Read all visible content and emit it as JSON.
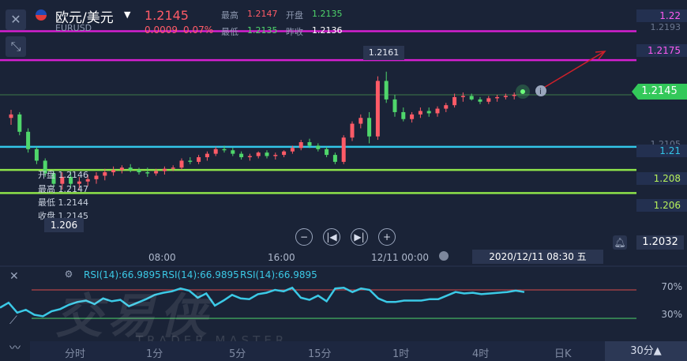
{
  "header": {
    "title": "欧元/美元",
    "symbol": "EURUSD",
    "last": "1.2145",
    "change": "0.0009",
    "change_pct": "0.07%",
    "high_label": "最高",
    "high": "1.2147",
    "open_label": "开盘",
    "open": "1.2135",
    "low_label": "最低",
    "low": "1.2135",
    "prev_label": "昨收",
    "prev": "1.2136"
  },
  "price_axis": {
    "tags": [
      {
        "name": "level-1.22",
        "value": "1.22",
        "color": "#d51fd0"
      },
      {
        "name": "level-1.2175",
        "value": "1.2175",
        "color": "#d51fd0"
      },
      {
        "name": "level-1.21",
        "value": "1.21",
        "color": "#33c6e8"
      },
      {
        "name": "level-1.208",
        "value": "1.208",
        "color": "#8ee34a"
      },
      {
        "name": "level-1.206",
        "value": "1.206",
        "color": "#8ee34a"
      }
    ],
    "faint_ticks": [
      "1.2193",
      "1.2105"
    ],
    "current_price": "1.2145",
    "alert_price": "1.2032",
    "peak_label": "1.2161"
  },
  "ohlc_tooltip": {
    "open_label": "开盘",
    "open": "1.2146",
    "high_label": "最高",
    "high": "1.2147",
    "low_label": "最低",
    "low": "1.2144",
    "close_label": "收盘",
    "close": "1.2145",
    "hover_price": "1.206"
  },
  "time_axis": {
    "ticks": [
      "08:00",
      "16:00",
      "12/11 00:00"
    ],
    "crosshair_time": "2020/12/11 08:30 五"
  },
  "rsi": {
    "labels": [
      "RSI(14):66.9895",
      "RSI(14):66.9895",
      "RSI(14):66.9895"
    ],
    "levels": [
      "70%",
      "30%"
    ]
  },
  "timeframes": [
    "分时",
    "1分",
    "5分",
    "15分",
    "1时",
    "4时",
    "日K",
    "30分▲"
  ],
  "watermark": {
    "main": "交易侠",
    "sub": "TRADER MASTER"
  },
  "colors": {
    "up": "#ff5b67",
    "down": "#4fd66b",
    "rsi": "#3bc9e6",
    "magenta": "#d51fd0",
    "cyan": "#33c6e8",
    "lime": "#8ee34a"
  },
  "chart_data": {
    "type": "candlestick",
    "ylim": [
      1.2022,
      1.2227
    ],
    "levels": [
      1.22,
      1.2175,
      1.21,
      1.208,
      1.206
    ],
    "current": 1.2145,
    "candles": [
      [
        1.2125,
        1.2132,
        1.2119,
        1.2128
      ],
      [
        1.2128,
        1.213,
        1.211,
        1.2113
      ],
      [
        1.2113,
        1.2116,
        1.2095,
        1.2098
      ],
      [
        1.2098,
        1.21,
        1.2085,
        1.2088
      ],
      [
        1.2088,
        1.209,
        1.2074,
        1.2077
      ],
      [
        1.2077,
        1.208,
        1.2065,
        1.2068
      ],
      [
        1.2068,
        1.2078,
        1.2063,
        1.2074
      ],
      [
        1.2074,
        1.2079,
        1.2065,
        1.2068
      ],
      [
        1.2068,
        1.2074,
        1.2063,
        1.207
      ],
      [
        1.207,
        1.2076,
        1.2066,
        1.2072
      ],
      [
        1.2072,
        1.2078,
        1.2068,
        1.2075
      ],
      [
        1.2075,
        1.2081,
        1.2071,
        1.2078
      ],
      [
        1.2078,
        1.2083,
        1.2075,
        1.208
      ],
      [
        1.208,
        1.2084,
        1.2077,
        1.2082
      ],
      [
        1.2082,
        1.2085,
        1.2078,
        1.208
      ],
      [
        1.208,
        1.2082,
        1.2076,
        1.2078
      ],
      [
        1.2078,
        1.2082,
        1.2074,
        1.2077
      ],
      [
        1.2077,
        1.2081,
        1.2075,
        1.2079
      ],
      [
        1.2079,
        1.2083,
        1.2076,
        1.2081
      ],
      [
        1.2081,
        1.2084,
        1.2079,
        1.2082
      ],
      [
        1.2082,
        1.209,
        1.208,
        1.2088
      ],
      [
        1.2088,
        1.2091,
        1.2085,
        1.2087
      ],
      [
        1.2087,
        1.2093,
        1.2085,
        1.2091
      ],
      [
        1.2091,
        1.2096,
        1.2088,
        1.2094
      ],
      [
        1.2094,
        1.21,
        1.2092,
        1.2098
      ],
      [
        1.2098,
        1.2101,
        1.2095,
        1.2097
      ],
      [
        1.2097,
        1.2099,
        1.2092,
        1.2094
      ],
      [
        1.2094,
        1.2096,
        1.2089,
        1.2091
      ],
      [
        1.2091,
        1.2094,
        1.2088,
        1.2092
      ],
      [
        1.2092,
        1.2096,
        1.209,
        1.2095
      ],
      [
        1.2095,
        1.2097,
        1.209,
        1.2092
      ],
      [
        1.2092,
        1.2095,
        1.2089,
        1.2093
      ],
      [
        1.2093,
        1.2097,
        1.2091,
        1.2096
      ],
      [
        1.2096,
        1.2101,
        1.2094,
        1.2099
      ],
      [
        1.2099,
        1.2106,
        1.2097,
        1.2104
      ],
      [
        1.2104,
        1.2107,
        1.2099,
        1.2101
      ],
      [
        1.2101,
        1.2103,
        1.2096,
        1.2098
      ],
      [
        1.2098,
        1.21,
        1.2091,
        1.2093
      ],
      [
        1.2093,
        1.2095,
        1.2085,
        1.2087
      ],
      [
        1.2087,
        1.211,
        1.2085,
        1.2108
      ],
      [
        1.2108,
        1.2122,
        1.2105,
        1.212
      ],
      [
        1.212,
        1.2128,
        1.2116,
        1.2125
      ],
      [
        1.2125,
        1.213,
        1.2103,
        1.2109
      ],
      [
        1.2109,
        1.2161,
        1.2106,
        1.2157
      ],
      [
        1.2157,
        1.2165,
        1.2138,
        1.2141
      ],
      [
        1.2141,
        1.2145,
        1.2126,
        1.213
      ],
      [
        1.213,
        1.2134,
        1.2122,
        1.2124
      ],
      [
        1.2124,
        1.213,
        1.2121,
        1.2128
      ],
      [
        1.2128,
        1.2134,
        1.2125,
        1.2131
      ],
      [
        1.2131,
        1.2134,
        1.2126,
        1.2129
      ],
      [
        1.2129,
        1.2135,
        1.2126,
        1.2133
      ],
      [
        1.2133,
        1.2138,
        1.213,
        1.2136
      ],
      [
        1.2136,
        1.2146,
        1.2134,
        1.2143
      ],
      [
        1.2143,
        1.2147,
        1.2139,
        1.2144
      ],
      [
        1.2144,
        1.2146,
        1.214,
        1.2141
      ],
      [
        1.2141,
        1.2143,
        1.2137,
        1.2139
      ],
      [
        1.2139,
        1.2144,
        1.2137,
        1.2142
      ],
      [
        1.2142,
        1.2145,
        1.2139,
        1.2143
      ],
      [
        1.2143,
        1.2146,
        1.2141,
        1.2144
      ],
      [
        1.2144,
        1.2147,
        1.2141,
        1.2145
      ]
    ],
    "rsi_values": [
      45,
      52,
      38,
      42,
      35,
      33,
      40,
      43,
      49,
      53,
      55,
      50,
      58,
      54,
      56,
      47,
      52,
      57,
      63,
      66,
      68,
      72,
      69,
      59,
      65,
      48,
      55,
      63,
      58,
      57,
      64,
      66,
      70,
      68,
      73,
      59,
      56,
      62,
      54,
      72,
      73,
      67,
      72,
      70,
      58,
      53,
      53,
      55,
      55,
      55,
      57,
      57,
      62,
      67,
      65,
      66,
      64,
      65,
      66,
      67,
      69,
      67
    ]
  }
}
